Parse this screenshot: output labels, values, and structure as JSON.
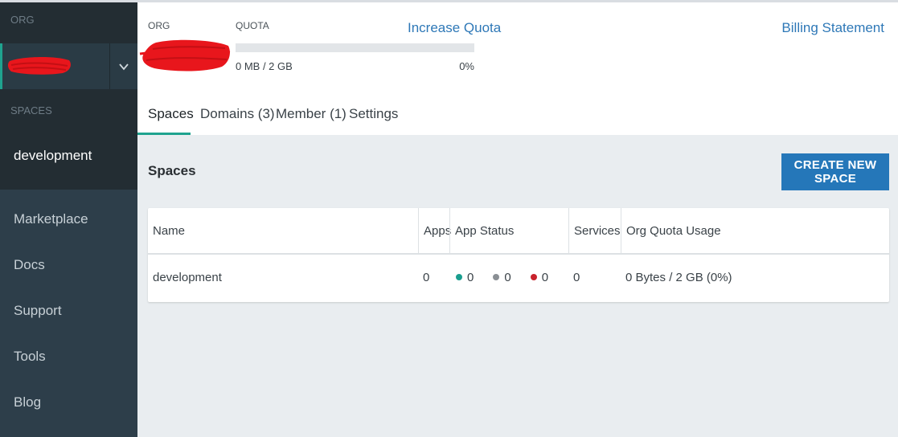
{
  "sidebar": {
    "org_label": "ORG",
    "spaces_label": "SPACES",
    "spaces": [
      "development"
    ],
    "nav": [
      "Marketplace",
      "Docs",
      "Support",
      "Tools",
      "Blog"
    ],
    "toggle_icon": "chevron-down-icon",
    "accent_color": "#1fa38f"
  },
  "header": {
    "org_label": "ORG",
    "quota_label": "QUOTA",
    "quota_used_text": "0 MB / 2 GB",
    "quota_percent_text": "0%",
    "quota_fraction": 0,
    "increase_quota": "Increase Quota",
    "billing_statement": "Billing Statement"
  },
  "tabs": [
    {
      "label": "Spaces",
      "active": true
    },
    {
      "label": "Domains (3)",
      "active": false
    },
    {
      "label": "Member (1)",
      "active": false
    },
    {
      "label": "Settings",
      "active": false
    }
  ],
  "main": {
    "title": "Spaces",
    "create_button": "CREATE NEW SPACE",
    "table": {
      "columns": [
        "Name",
        "Apps",
        "App Status",
        "Services",
        "Org Quota Usage"
      ],
      "rows": [
        {
          "name": "development",
          "apps": "0",
          "status": [
            {
              "color": "#1a9e8f",
              "value": "0"
            },
            {
              "color": "#8a8f94",
              "value": "0"
            },
            {
              "color": "#c8232c",
              "value": "0"
            }
          ],
          "services": "0",
          "quota_usage": "0 Bytes / 2 GB (0%)"
        }
      ]
    }
  },
  "colors": {
    "primary": "#2577b9",
    "link": "#2e78b7",
    "sidebar_bg": "#2d3e4a",
    "redaction": "#e8161c"
  }
}
